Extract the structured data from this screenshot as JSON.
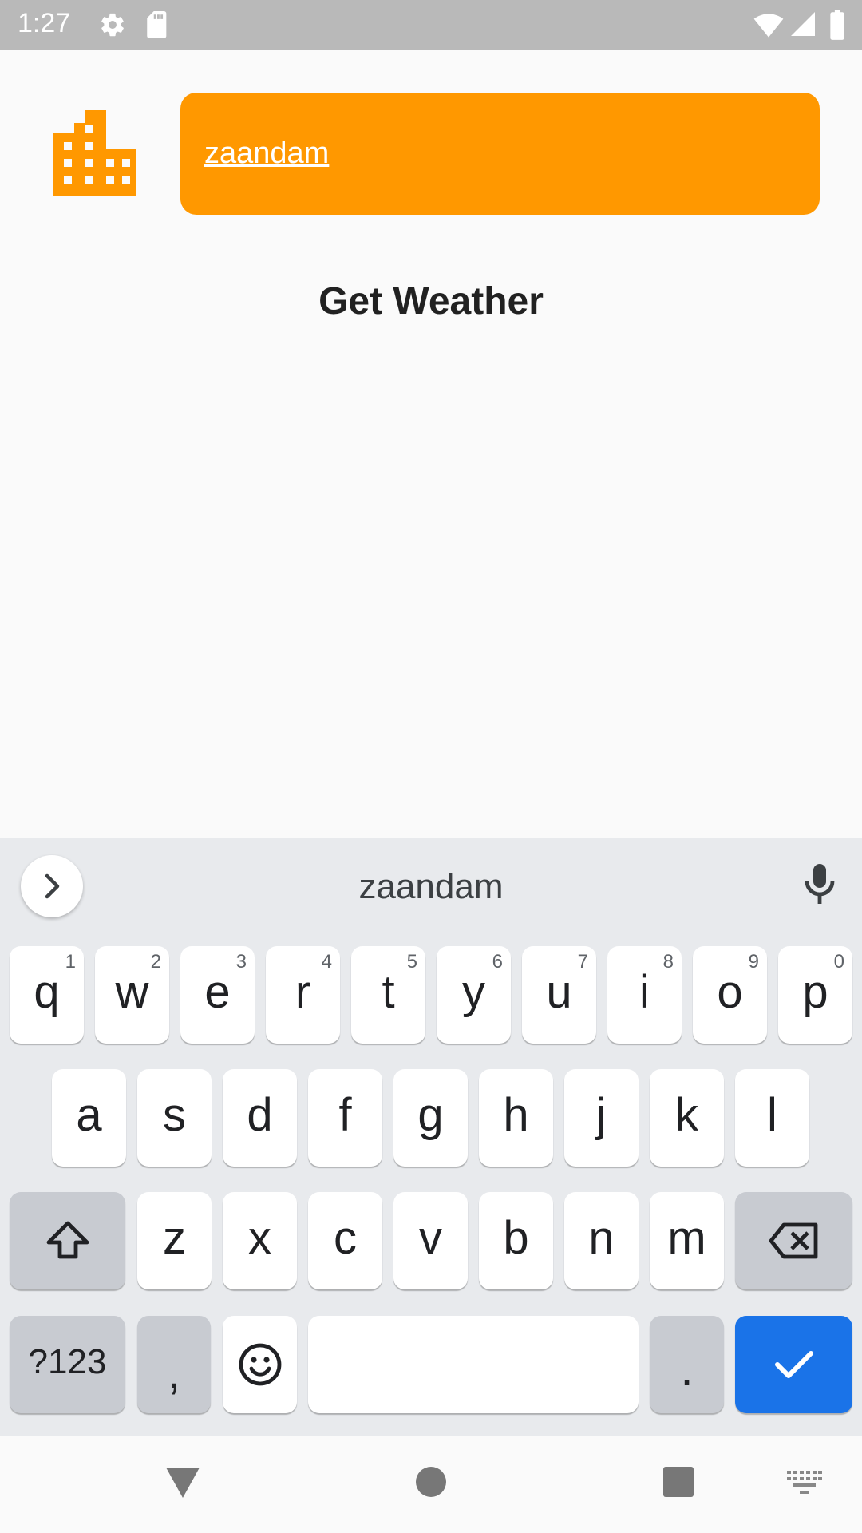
{
  "status_bar": {
    "time": "1:27"
  },
  "app": {
    "city_input_value": "zaandam",
    "get_weather_label": "Get Weather",
    "accent_color": "#ff9800"
  },
  "keyboard": {
    "suggestion": "zaandam",
    "row1": [
      {
        "label": "q",
        "hint": "1"
      },
      {
        "label": "w",
        "hint": "2"
      },
      {
        "label": "e",
        "hint": "3"
      },
      {
        "label": "r",
        "hint": "4"
      },
      {
        "label": "t",
        "hint": "5"
      },
      {
        "label": "y",
        "hint": "6"
      },
      {
        "label": "u",
        "hint": "7"
      },
      {
        "label": "i",
        "hint": "8"
      },
      {
        "label": "o",
        "hint": "9"
      },
      {
        "label": "p",
        "hint": "0"
      }
    ],
    "row2": [
      "a",
      "s",
      "d",
      "f",
      "g",
      "h",
      "j",
      "k",
      "l"
    ],
    "row3": [
      "z",
      "x",
      "c",
      "v",
      "b",
      "n",
      "m"
    ],
    "symbols_label": "?123",
    "comma_label": ",",
    "period_label": ".",
    "enter_color": "#1a73e8"
  },
  "icons": {
    "status": [
      "gear-icon",
      "sd-card-icon",
      "wifi-icon",
      "cell-signal-icon",
      "battery-icon"
    ],
    "nav": [
      "back-icon",
      "home-icon",
      "recents-icon",
      "keyboard-switch-icon"
    ]
  }
}
